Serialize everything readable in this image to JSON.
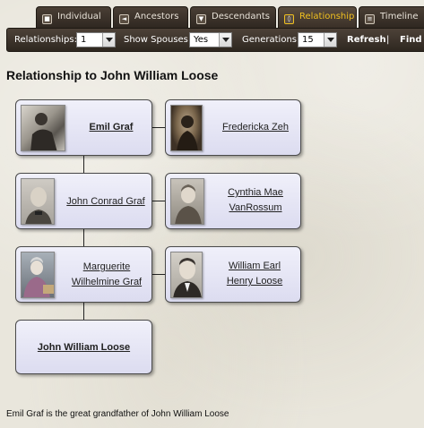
{
  "tabs": [
    {
      "label": "Individual",
      "icon": "individual-icon",
      "active": false
    },
    {
      "label": "Ancestors",
      "icon": "ancestors-icon",
      "active": false
    },
    {
      "label": "Descendants",
      "icon": "descendants-icon",
      "active": false
    },
    {
      "label": "Relationship",
      "icon": "relationship-icon",
      "active": true
    },
    {
      "label": "Timeline",
      "icon": "timeline-icon",
      "active": false
    }
  ],
  "toolbar": {
    "relationships_label": "Relationships:",
    "relationships_value": "1",
    "show_spouses_label": "Show Spouses:",
    "show_spouses_value": "Yes",
    "generations_label": "Generations:",
    "generations_value": "15",
    "refresh_label": "Refresh",
    "separator": "|",
    "find_label": "Find a"
  },
  "page_title": "Relationship to John William Loose",
  "people": {
    "emil": {
      "name": "Emil Graf",
      "photo": "portrait-photo"
    },
    "fredericka": {
      "name": "Fredericka Zeh",
      "photo": "portrait-photo"
    },
    "john_conrad": {
      "name": "John Conrad Graf",
      "photo": "portrait-photo"
    },
    "cynthia": {
      "name_line1": "Cynthia Mae",
      "name_line2": "VanRossum",
      "photo": "portrait-photo"
    },
    "marguerite": {
      "name_line1": "Marguerite",
      "name_line2": "Wilhelmine Graf",
      "photo": "portrait-photo"
    },
    "william": {
      "name_line1": "William Earl",
      "name_line2": "Henry Loose",
      "photo": "portrait-photo"
    },
    "john_william": {
      "name": "John William Loose"
    }
  },
  "summary": "Emil Graf is the great grandfather of John William Loose",
  "colors": {
    "active_tab_text": "#f0c020",
    "box_fill_top": "#f0f0fa",
    "box_fill_bottom": "#dcdcf0"
  }
}
